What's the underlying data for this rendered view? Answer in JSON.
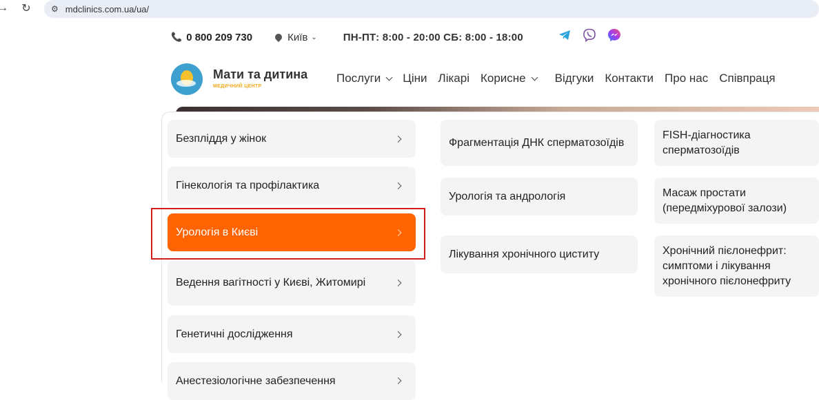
{
  "browser": {
    "url": "mdclinics.com.ua/ua/"
  },
  "topbar": {
    "phone": "0 800 209 730",
    "city": "Київ",
    "hours": "ПН-ПТ: 8:00 - 20:00  СБ: 8:00 - 18:00"
  },
  "brand": {
    "name": "Мати та дитина",
    "subtitle": "МЕДИЧНИЙ ЦЕНТР"
  },
  "menu": {
    "items": [
      "Послуги",
      "Ціни",
      "Лікарі",
      "Корисне",
      "Відгуки",
      "Контакти",
      "Про нас",
      "Співпраця"
    ]
  },
  "categories": [
    "Безпліддя у жінок",
    "Гінекологія та профілактика",
    "Урологія в Києві",
    "Ведення вагітності у Києві, Житомирі",
    "Генетичні дослідження",
    "Анестезіологічне забезпечення"
  ],
  "subcategories": {
    "col1": [
      "Фрагментація ДНК сперматозоїдів",
      "Урологія та андрологія",
      "Лікування хронічного циститу"
    ],
    "col2": [
      "FISH-діагностика сперматозоїдів",
      "Масаж простати (передміхурової залози)",
      "Хронічний пієлонефрит: симптоми і лікування хронічного пієлонефриту"
    ]
  },
  "colors": {
    "accent": "#ff6400",
    "highlight_border": "#d21b1b",
    "telegram": "#2aa3dc",
    "viber": "#7d51a0",
    "messenger": "#7a5af8"
  }
}
